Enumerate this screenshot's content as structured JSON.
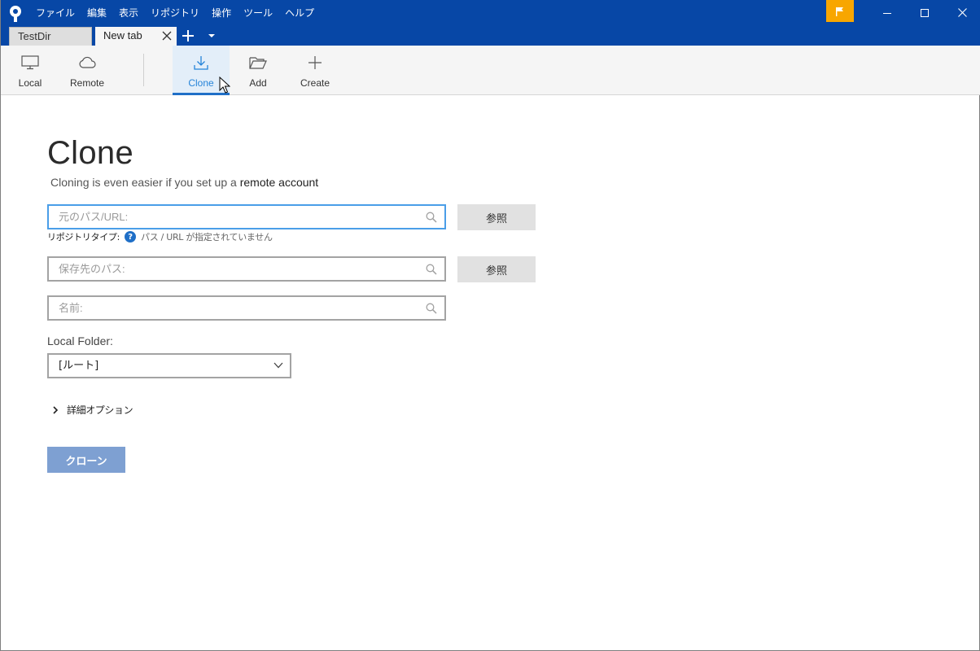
{
  "menu": [
    "ファイル",
    "編集",
    "表示",
    "リポジトリ",
    "操作",
    "ツール",
    "ヘルプ"
  ],
  "tabs": [
    {
      "label": "TestDir",
      "active": false
    },
    {
      "label": "New tab",
      "active": true
    }
  ],
  "toolbar": {
    "local": "Local",
    "remote": "Remote",
    "clone": "Clone",
    "add": "Add",
    "create": "Create"
  },
  "content": {
    "title": "Clone",
    "subtitle_prefix": "Cloning is even easier if you set up a ",
    "subtitle_link": "remote account",
    "source_placeholder": "元のパス/URL:",
    "browse_label": "参照",
    "repo_type_key": "リポジトリタイプ:",
    "repo_type_value": "パス / URL が指定されていません",
    "dest_placeholder": "保存先のパス:",
    "name_placeholder": "名前:",
    "local_folder_label": "Local Folder:",
    "local_folder_value": "[ルート]",
    "advanced_options": "詳細オプション",
    "clone_button": "クローン"
  },
  "colors": {
    "titlebar": "#0747a6",
    "accent": "#1f6fc7",
    "flag": "#f8a600",
    "clone_button": "#7ea0d2"
  }
}
